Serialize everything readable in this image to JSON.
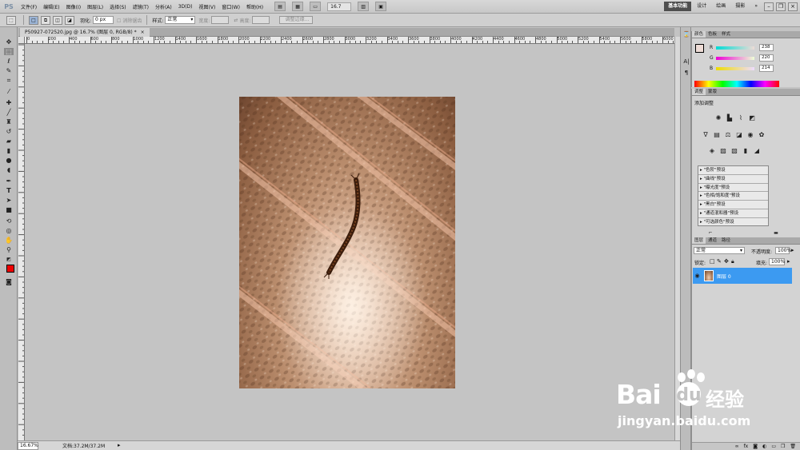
{
  "menubar": {
    "logo": "PS",
    "items": [
      "文件(F)",
      "编辑(E)",
      "图像(I)",
      "图层(L)",
      "选择(S)",
      "滤镜(T)",
      "分析(A)",
      "3D(D)",
      "视图(V)",
      "窗口(W)",
      "帮助(H)"
    ],
    "zoom": "16.7",
    "workspaces": [
      "基本功能",
      "设计",
      "绘画",
      "摄影"
    ],
    "more": "»"
  },
  "options": {
    "feather_label": "羽化:",
    "feather_value": "0 px",
    "antialias_label": "消除锯齿",
    "style_label": "样式:",
    "style_value": "正常",
    "width_label": "宽度:",
    "height_label": "高度:",
    "refine_edge": "调整边缘..."
  },
  "document": {
    "tab_title": "P50927-072520.jpg @ 16.7% (图层 0, RGB/8) *",
    "ruler_h": [
      "0",
      "200",
      "400",
      "600",
      "800",
      "1000",
      "1200",
      "1400",
      "1600",
      "1800",
      "2000",
      "2200",
      "2400",
      "2600",
      "2800",
      "3000",
      "3200",
      "3400",
      "3600",
      "3800",
      "4000",
      "4200",
      "4400",
      "4600",
      "4800",
      "5000",
      "5200",
      "5400",
      "5600",
      "5800",
      "6000",
      "6200"
    ],
    "status_zoom": "16.67%",
    "status_doc": "文档:37.2M/37.2M"
  },
  "color_panel": {
    "tabs": [
      "颜色",
      "色板",
      "样式"
    ],
    "r_label": "R",
    "r_value": "238",
    "g_label": "G",
    "g_value": "220",
    "b_label": "B",
    "b_value": "214"
  },
  "adjust_panel": {
    "tabs": [
      "调整",
      "蒙版"
    ],
    "title": "添加调整",
    "presets": [
      "\"色阶\"预设",
      "\"曲线\"预设",
      "\"曝光度\"预设",
      "\"色相/饱和度\"预设",
      "\"黑白\"预设",
      "\"通道混和器\"预设",
      "\"可选颜色\"预设"
    ]
  },
  "layers_panel": {
    "tabs": [
      "图层",
      "通道",
      "路径"
    ],
    "blend_mode": "正常",
    "opacity_label": "不透明度:",
    "opacity_value": "100%",
    "lock_label": "锁定:",
    "fill_label": "填充:",
    "fill_value": "100%",
    "layer_name": "图层 0"
  },
  "watermark": {
    "brand": "Bai",
    "brand_suffix": "经验",
    "url": "jingyan.baidu.com"
  }
}
